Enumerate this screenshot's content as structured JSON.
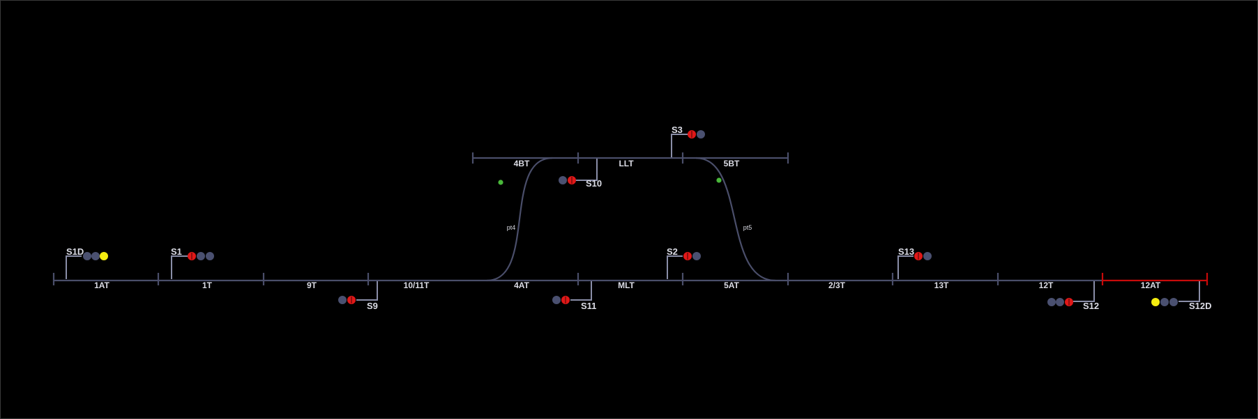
{
  "colors": {
    "track": "#4a4e6a",
    "occupied": "#c80a0a",
    "red": "#e01818",
    "yellow": "#f4ec10",
    "off": "#4a5070",
    "point_indicator": "#49b83a",
    "background": "#000000"
  },
  "sections": {
    "1AT": "1AT",
    "1T": "1T",
    "9T": "9T",
    "10_11T": "10/11T",
    "4AT": "4AT",
    "MLT": "MLT",
    "5AT": "5AT",
    "2_3T": "2/3T",
    "13T": "13T",
    "12T": "12T",
    "12AT": "12AT",
    "4BT": "4BT",
    "LLT": "LLT",
    "5BT": "5BT"
  },
  "points": {
    "pt4": "pt4",
    "pt5": "pt5"
  },
  "signals": {
    "S1D": {
      "label": "S1D",
      "aspect": "yellow"
    },
    "S1": {
      "label": "S1",
      "aspect": "red"
    },
    "S9": {
      "label": "S9",
      "aspect": "red"
    },
    "S11": {
      "label": "S11",
      "aspect": "red"
    },
    "S2": {
      "label": "S2",
      "aspect": "red"
    },
    "S3": {
      "label": "S3",
      "aspect": "red"
    },
    "S10": {
      "label": "S10",
      "aspect": "red"
    },
    "S13": {
      "label": "S13",
      "aspect": "red"
    },
    "S12": {
      "label": "S12",
      "aspect": "red"
    },
    "S12D": {
      "label": "S12D",
      "aspect": "yellow"
    }
  },
  "occupied_sections": [
    "12AT"
  ]
}
